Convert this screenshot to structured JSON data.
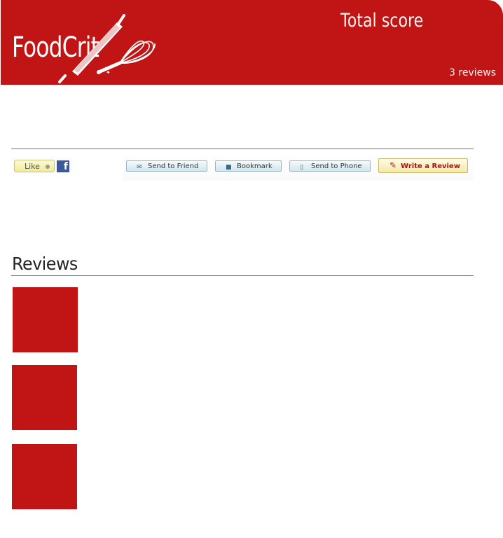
{
  "header": {
    "logo_text": "FoodCrit",
    "total_score_label": "Total score",
    "reviews_count": "3 reviews",
    "brand_color": "#c11414"
  },
  "share": {
    "like_label": "Like",
    "facebook_icon": "f",
    "send_to_friend": "Send to Friend",
    "bookmark": "Bookmark",
    "send_to_phone": "Send to Phone",
    "write_review": "Write a Review"
  },
  "reviews": {
    "title": "Reviews",
    "items": [
      {
        "avatar": "avatar-1"
      },
      {
        "avatar": "avatar-2"
      },
      {
        "avatar": "avatar-3"
      }
    ]
  }
}
